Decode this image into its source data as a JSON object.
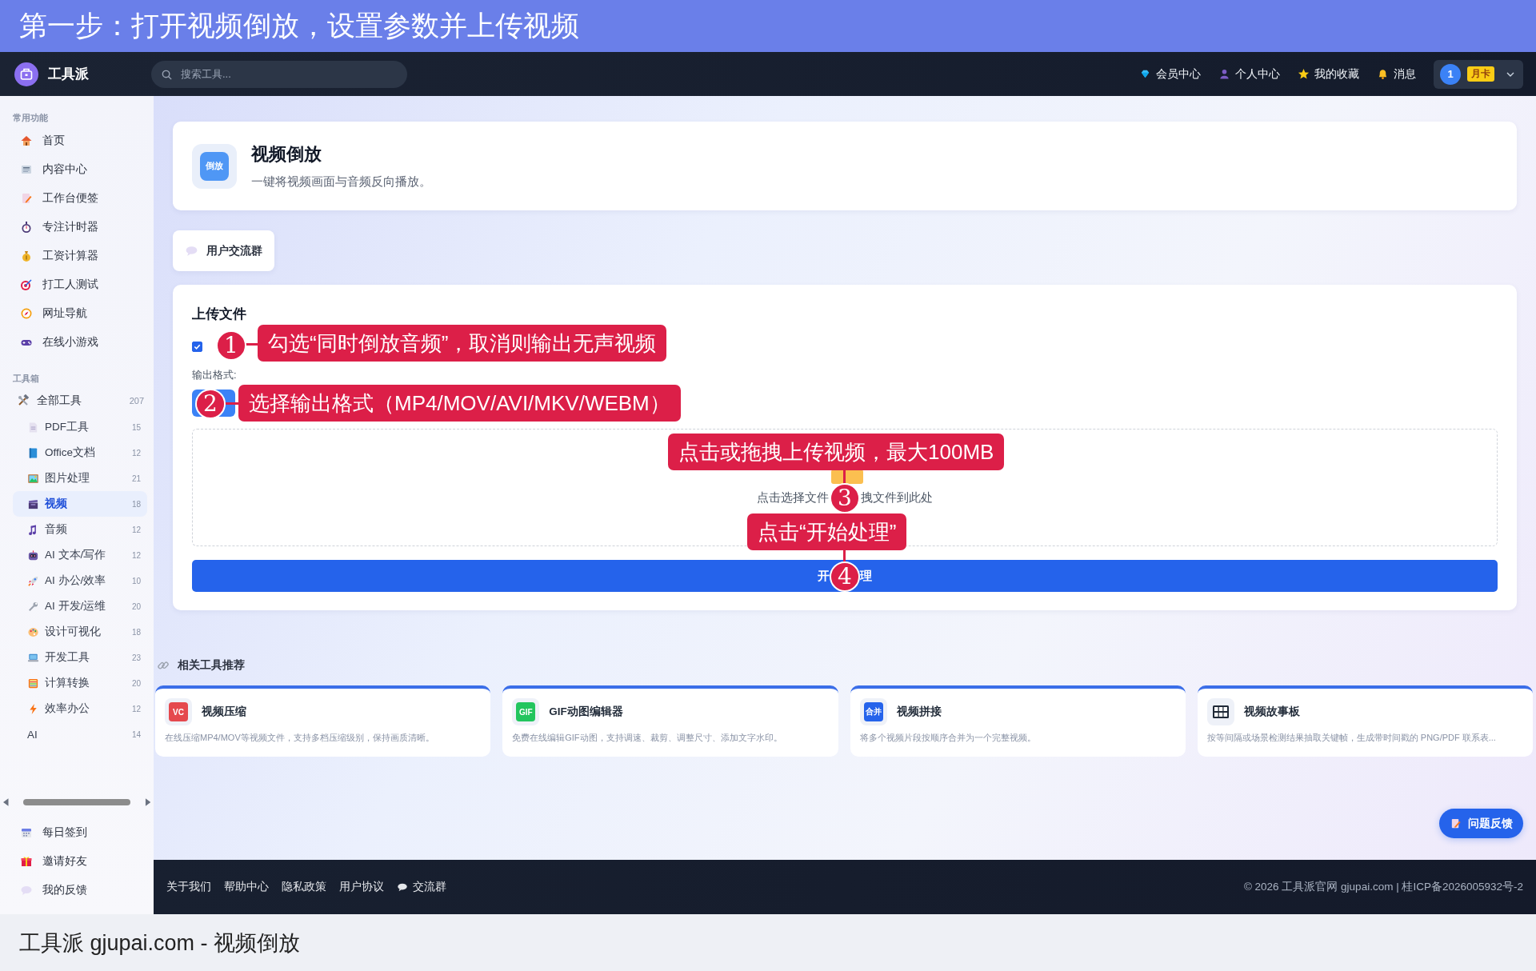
{
  "caption_top": "第一步：打开视频倒放，设置参数并上传视频",
  "navbar": {
    "brand": "工具派",
    "search": {
      "placeholder": "搜索工具..."
    },
    "links": [
      {
        "label": "会员中心"
      },
      {
        "label": "个人中心"
      },
      {
        "label": "我的收藏"
      },
      {
        "label": "消息"
      }
    ],
    "user": {
      "avatar": "1",
      "badge": "月卡"
    }
  },
  "sidebar": {
    "sections": [
      {
        "title": "常用功能",
        "items": [
          {
            "label": "首页",
            "selected": false
          },
          {
            "label": "内容中心",
            "selected": false
          },
          {
            "label": "工作台便签",
            "selected": false
          },
          {
            "label": "专注计时器",
            "selected": false
          },
          {
            "label": "工资计算器",
            "selected": false
          },
          {
            "label": "打工人测试",
            "selected": false
          },
          {
            "label": "网址导航",
            "selected": false
          },
          {
            "label": "在线小游戏",
            "selected": false
          }
        ]
      },
      {
        "title": "工具箱",
        "items": [
          {
            "label": "全部工具",
            "count": "207",
            "selected": false,
            "children": [
              {
                "label": "PDF工具",
                "count": "15",
                "selected": false
              },
              {
                "label": "Office文档",
                "count": "12",
                "selected": false
              },
              {
                "label": "图片处理",
                "count": "21",
                "selected": false
              },
              {
                "label": "视频",
                "count": "18",
                "selected": true
              },
              {
                "label": "音频",
                "count": "12",
                "selected": false
              },
              {
                "label": "AI 文本/写作",
                "count": "12",
                "selected": false
              },
              {
                "label": "AI 办公/效率",
                "count": "10",
                "selected": false
              },
              {
                "label": "AI 开发/运维",
                "count": "20",
                "selected": false
              },
              {
                "label": "设计可视化",
                "count": "18",
                "selected": false
              },
              {
                "label": "开发工具",
                "count": "23",
                "selected": false
              },
              {
                "label": "计算转换",
                "count": "20",
                "selected": false
              },
              {
                "label": "效率办公",
                "count": "12",
                "selected": false
              },
              {
                "label": "AI",
                "count": "14",
                "selected": false
              }
            ]
          }
        ]
      }
    ],
    "bottom_items": [
      {
        "label": "每日签到"
      },
      {
        "label": "邀请好友"
      },
      {
        "label": "我的反馈"
      }
    ]
  },
  "tool_header": {
    "icon_text": "倒放",
    "title": "视频倒放",
    "description": "一键将视频画面与音频反向播放。"
  },
  "group_button": "用户交流群",
  "upload": {
    "title": "上传文件",
    "checkbox": {
      "checked": true
    },
    "format_label": "输出格式:",
    "drop_text_parts": [
      "点击选择文件",
      "拽文件到此处"
    ],
    "button_text_parts": [
      "开",
      "理"
    ]
  },
  "annotations": [
    {
      "number": "1",
      "text": "勾选“同时倒放音频”，取消则输出无声视频"
    },
    {
      "number": "2",
      "text": "选择输出格式（MP4/MOV/AVI/MKV/WEBM）"
    },
    {
      "number": "3",
      "text": "点击或拖拽上传视频，最大100MB"
    },
    {
      "number": "4",
      "text": "点击“开始处理”"
    }
  ],
  "related": {
    "title": "相关工具推荐",
    "cards": [
      {
        "icon_text": "VC",
        "title": "视频压缩",
        "description": "在线压缩MP4/MOV等视频文件，支持多档压缩级别，保持画质清晰。"
      },
      {
        "icon_text": "GIF",
        "title": "GIF动图编辑器",
        "description": "免费在线编辑GIF动图，支持调速、裁剪、调整尺寸、添加文字水印。"
      },
      {
        "icon_text": "合并",
        "title": "视频拼接",
        "description": "将多个视频片段按顺序合并为一个完整视频。"
      },
      {
        "title": "视频故事板",
        "description": "按等间隔或场景检测结果抽取关键帧，生成带时间戳的 PNG/PDF 联系表..."
      }
    ]
  },
  "feedback_button": "问题反馈",
  "footer": {
    "links": [
      "关于我们",
      "帮助中心",
      "隐私政策",
      "用户协议",
      "交流群"
    ],
    "copyright": "© 2026 工具派官网 gjupai.com | 桂ICP备2026005932号-2"
  },
  "caption_bottom": "工具派 gjupai.com - 视频倒放"
}
